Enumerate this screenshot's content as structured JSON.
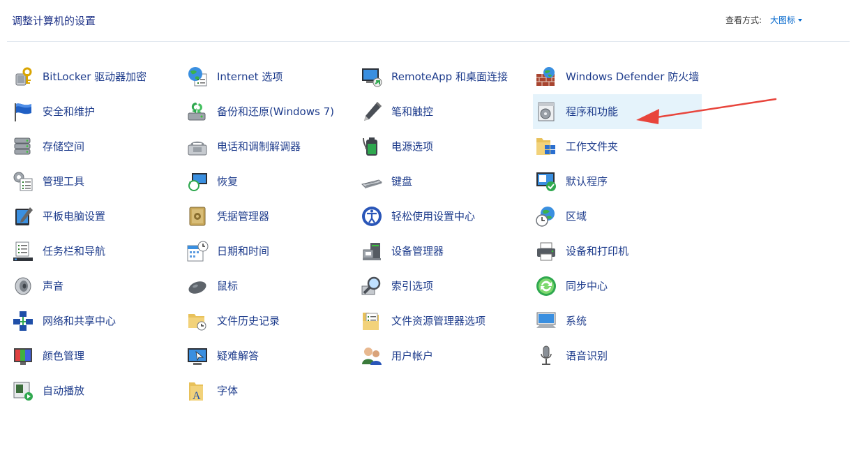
{
  "header": {
    "title": "调整计算机的设置",
    "view_label": "查看方式:",
    "view_value": "大图标"
  },
  "colors": {
    "link": "#1e3c8c",
    "accent": "#0066cc",
    "highlight": "#e5f3fb",
    "annotation_arrow": "#e8453c"
  },
  "columns": [
    [
      {
        "label": "BitLocker 驱动器加密",
        "icon": "bitlocker-key-icon"
      },
      {
        "label": "安全和维护",
        "icon": "flag-icon"
      },
      {
        "label": "存储空间",
        "icon": "storage-spaces-icon"
      },
      {
        "label": "管理工具",
        "icon": "admin-tools-icon"
      },
      {
        "label": "平板电脑设置",
        "icon": "tablet-pen-icon"
      },
      {
        "label": "任务栏和导航",
        "icon": "taskbar-icon"
      },
      {
        "label": "声音",
        "icon": "speaker-icon"
      },
      {
        "label": "网络和共享中心",
        "icon": "network-icon"
      },
      {
        "label": "颜色管理",
        "icon": "color-management-icon"
      },
      {
        "label": "自动播放",
        "icon": "autoplay-icon"
      }
    ],
    [
      {
        "label": "Internet 选项",
        "icon": "internet-options-icon"
      },
      {
        "label": "备份和还原(Windows 7)",
        "icon": "backup-restore-icon"
      },
      {
        "label": "电话和调制解调器",
        "icon": "phone-modem-icon"
      },
      {
        "label": "恢复",
        "icon": "recovery-icon"
      },
      {
        "label": "凭据管理器",
        "icon": "credential-vault-icon"
      },
      {
        "label": "日期和时间",
        "icon": "calendar-clock-icon"
      },
      {
        "label": "鼠标",
        "icon": "mouse-icon"
      },
      {
        "label": "文件历史记录",
        "icon": "file-history-icon"
      },
      {
        "label": "疑难解答",
        "icon": "troubleshoot-icon"
      },
      {
        "label": "字体",
        "icon": "fonts-folder-icon"
      }
    ],
    [
      {
        "label": "RemoteApp 和桌面连接",
        "icon": "remoteapp-icon"
      },
      {
        "label": "笔和触控",
        "icon": "pen-icon"
      },
      {
        "label": "电源选项",
        "icon": "power-options-icon"
      },
      {
        "label": "键盘",
        "icon": "keyboard-icon"
      },
      {
        "label": "轻松使用设置中心",
        "icon": "ease-of-access-icon"
      },
      {
        "label": "设备管理器",
        "icon": "device-manager-icon"
      },
      {
        "label": "索引选项",
        "icon": "indexing-icon"
      },
      {
        "label": "文件资源管理器选项",
        "icon": "explorer-options-icon"
      },
      {
        "label": "用户帐户",
        "icon": "user-accounts-icon"
      }
    ],
    [
      {
        "label": "Windows Defender 防火墙",
        "icon": "firewall-icon"
      },
      {
        "label": "程序和功能",
        "icon": "programs-features-icon",
        "highlighted": true
      },
      {
        "label": "工作文件夹",
        "icon": "work-folders-icon"
      },
      {
        "label": "默认程序",
        "icon": "default-programs-icon"
      },
      {
        "label": "区域",
        "icon": "region-icon"
      },
      {
        "label": "设备和打印机",
        "icon": "printer-icon"
      },
      {
        "label": "同步中心",
        "icon": "sync-center-icon"
      },
      {
        "label": "系统",
        "icon": "system-icon"
      },
      {
        "label": "语音识别",
        "icon": "microphone-icon"
      }
    ]
  ]
}
